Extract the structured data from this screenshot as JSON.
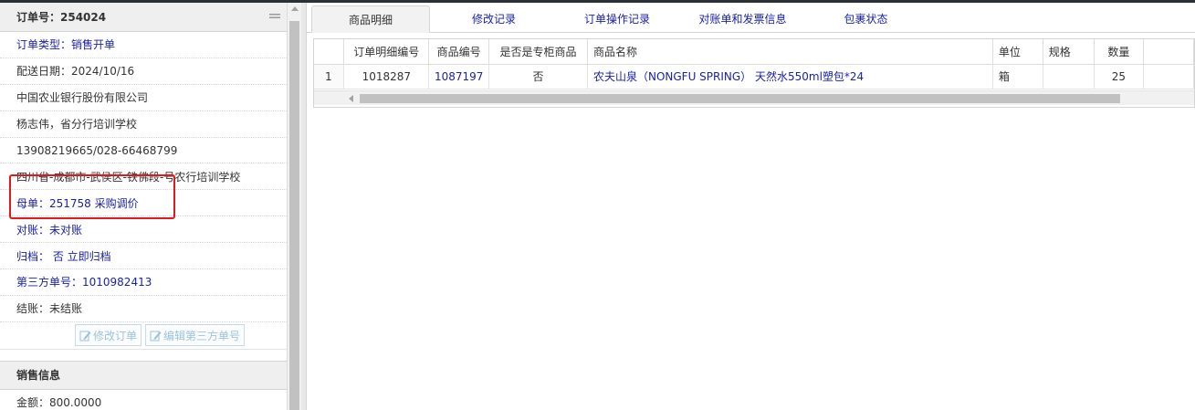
{
  "order": {
    "header": "订单号：254024",
    "rows": [
      {
        "text": "订单类型：销售开单",
        "style": "blue"
      },
      {
        "text": "配送日期：2024/10/16",
        "style": "dark"
      },
      {
        "text": "中国农业银行股份有限公司",
        "style": "dark"
      },
      {
        "text": "杨志伟，省分行培训学校",
        "style": "dark"
      },
      {
        "text": "13908219665/028-66468799",
        "style": "dark"
      },
      {
        "text": "四川省-成都市-武侯区-铁佛段-号农行培训学校",
        "style": "dark"
      },
      {
        "text": "母单：251758 采购调价",
        "style": "blue"
      },
      {
        "text": "对账：未对账",
        "style": "blue"
      },
      {
        "text": "归档： 否 立即归档",
        "style": "blue"
      },
      {
        "text": "第三方单号：1010982413",
        "style": "blue"
      },
      {
        "text": "结账：未结账",
        "style": "dark"
      }
    ],
    "buttons": {
      "modify_order": "修改订单",
      "edit_third_party": "编辑第三方单号"
    }
  },
  "sales": {
    "header": "销售信息",
    "amount": "金额：800.0000"
  },
  "tabs": [
    "商品明细",
    "修改记录",
    "订单操作记录",
    "对账单和发票信息",
    "包裹状态"
  ],
  "active_tab": "商品明细",
  "grid": {
    "columns": [
      "订单明细编号",
      "商品编号",
      "是否是专柜商品",
      "商品名称",
      "单位",
      "规格",
      "数量"
    ],
    "rows": [
      {
        "rownum": "1",
        "detail_id": "1018287",
        "product_id": "1087197",
        "is_counter": "否",
        "name": "农夫山泉（NONGFU SPRING） 天然水550ml塑包*24",
        "unit": "箱",
        "spec": "",
        "qty": "25"
      }
    ]
  },
  "colors": {
    "link_blue": "#1a22a6",
    "highlight_red": "#e0191c",
    "disabled_button": "#9cc3da"
  }
}
